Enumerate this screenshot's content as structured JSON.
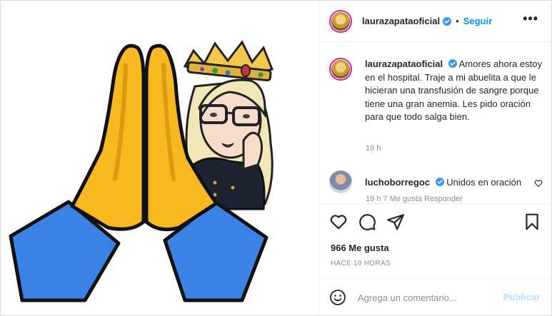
{
  "post": {
    "username": "laurazapataoficial",
    "follow_label": "Seguir",
    "more_label": "•••",
    "caption_text": "Amores ahora estoy en el hospital. Traje a mi abuelita a que le hicieran una transfusión de sangre porque tiene una gran anemia. Les pido oración para que todo salga bien.",
    "caption_time": "19 h",
    "likes": "966 Me gusta",
    "posted_ago": "HACE 19 HORAS"
  },
  "comments": [
    {
      "username": "luchoborregoc",
      "text": "Unidos en oración",
      "meta": "19 h    7 Me gusta    Responder"
    }
  ],
  "add_comment": {
    "placeholder": "Agrega un comentario...",
    "publish_label": "Publicar"
  },
  "colors": {
    "accent": "#0095f6",
    "publish_disabled": "#b2dffc",
    "secondary_text": "#8e8e8e"
  },
  "icons": [
    "verified-icon",
    "more-icon",
    "heart-icon",
    "comment-icon",
    "share-icon",
    "bookmark-icon",
    "emoji-icon"
  ]
}
